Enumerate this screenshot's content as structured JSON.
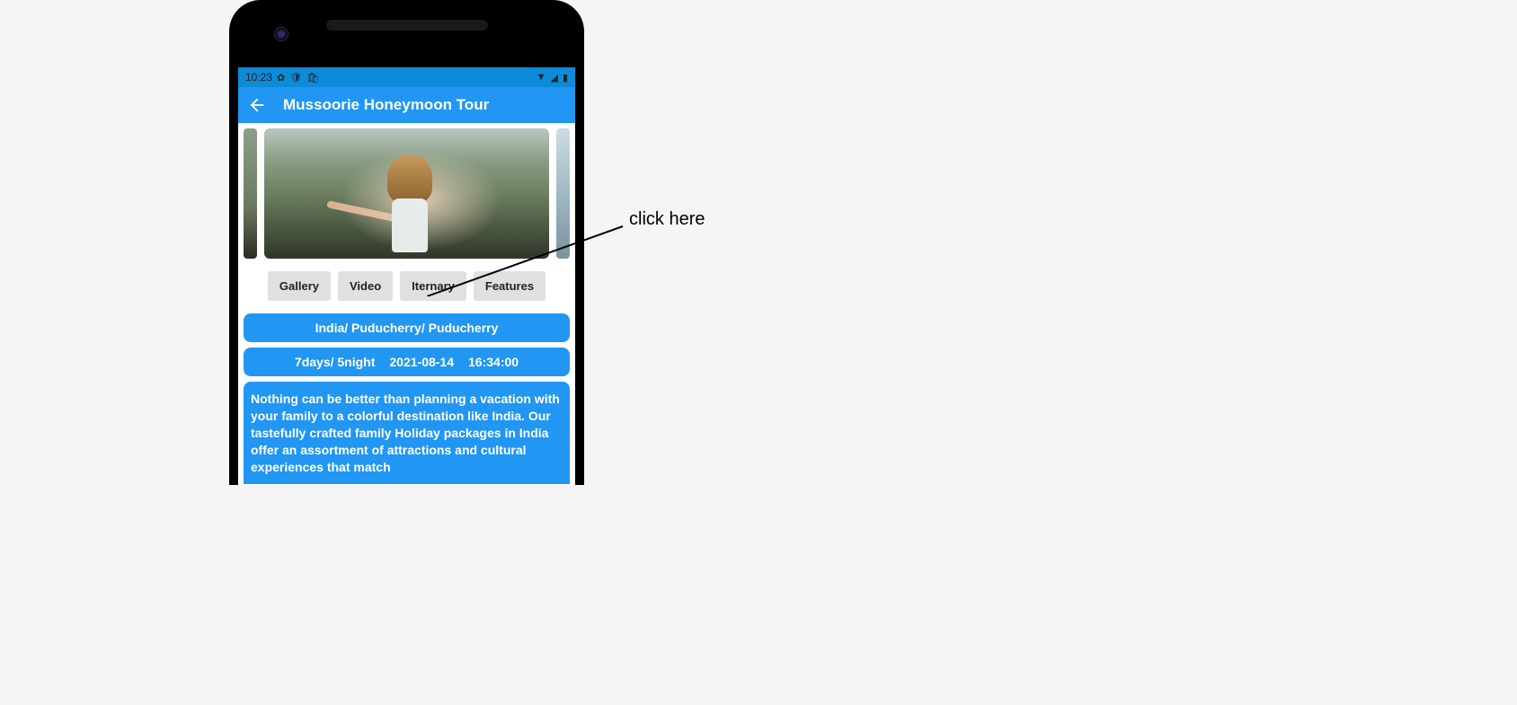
{
  "status_bar": {
    "time": "10:23",
    "icons_left": [
      "gear-icon",
      "shield-icon",
      "briefcase-icon"
    ],
    "icons_right": [
      "wifi-icon",
      "signal-icon",
      "battery-icon"
    ]
  },
  "app_bar": {
    "title": "Mussoorie Honeymoon Tour"
  },
  "tabs": {
    "gallery": "Gallery",
    "video": "Video",
    "iternary": "Iternary",
    "features": "Features"
  },
  "location": "India/  Puducherry/  Puducherry",
  "duration": "7days/ 5night",
  "date": "2021-08-14",
  "time": "16:34:00",
  "description": "Nothing can be better than planning a vacation with your family to a colorful destination like India. Our tastefully crafted family Holiday packages in India offer an assortment of attractions and cultural experiences that match",
  "annotation": {
    "label": "click here"
  }
}
